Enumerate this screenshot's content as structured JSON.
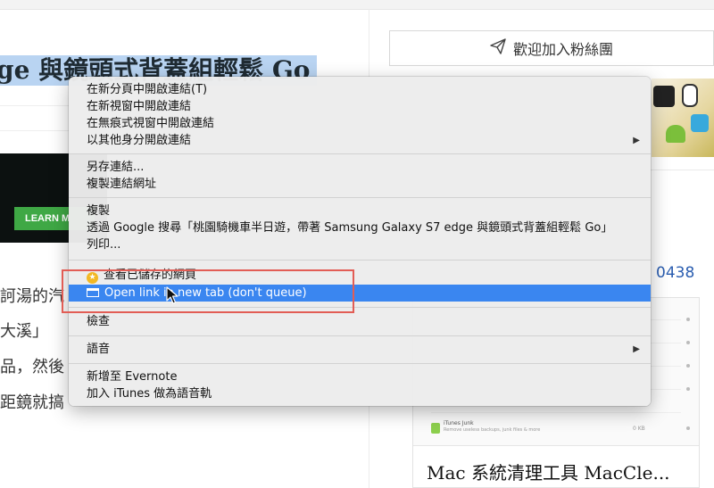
{
  "page": {
    "headline": "ge 與鏡頭式背蓋組輕鬆 Go",
    "ad_button": "LEARN M",
    "body_lines": [
      "訶湯的汽",
      "大溪」",
      "品，然後",
      "距鏡就搞"
    ],
    "fan_button": "歡迎加入粉絲團",
    "count_link": "0438",
    "card_junk_label": "iTunes Junk",
    "card_junk_sub": "Remove useless backups, junk files & more",
    "card_junk_size": "0 KB",
    "card_title": "Mac 系統清理工具 MacCle..."
  },
  "menu": {
    "items": [
      {
        "label": "在新分頁中開啟連結(T)"
      },
      {
        "label": "在新視窗中開啟連結"
      },
      {
        "label": "在無痕式視窗中開啟連結"
      },
      {
        "label": "以其他身分開啟連結",
        "submenu": "▶"
      },
      {
        "label": "另存連結..."
      },
      {
        "label": "複製連結網址"
      },
      {
        "label": "複製"
      },
      {
        "label": "透過 Google 搜尋「桃園騎機車半日遊，帶著 Samsung Galaxy S7 edge 與鏡頭式背蓋組輕鬆 Go」"
      },
      {
        "label": "列印..."
      },
      {
        "label": "查看已儲存的網頁",
        "icon": "star-icon"
      },
      {
        "label": "Open link in new tab (don't queue)",
        "icon": "tab-icon"
      },
      {
        "label": "檢查"
      },
      {
        "label": "語音",
        "submenu": "▶"
      },
      {
        "label": "新增至 Evernote"
      },
      {
        "label": "加入 iTunes 做為語音軌"
      }
    ]
  },
  "colors": {
    "highlight": "#3a86f0",
    "annotation_box": "#e25d55",
    "selection": "#b9d4f2"
  }
}
